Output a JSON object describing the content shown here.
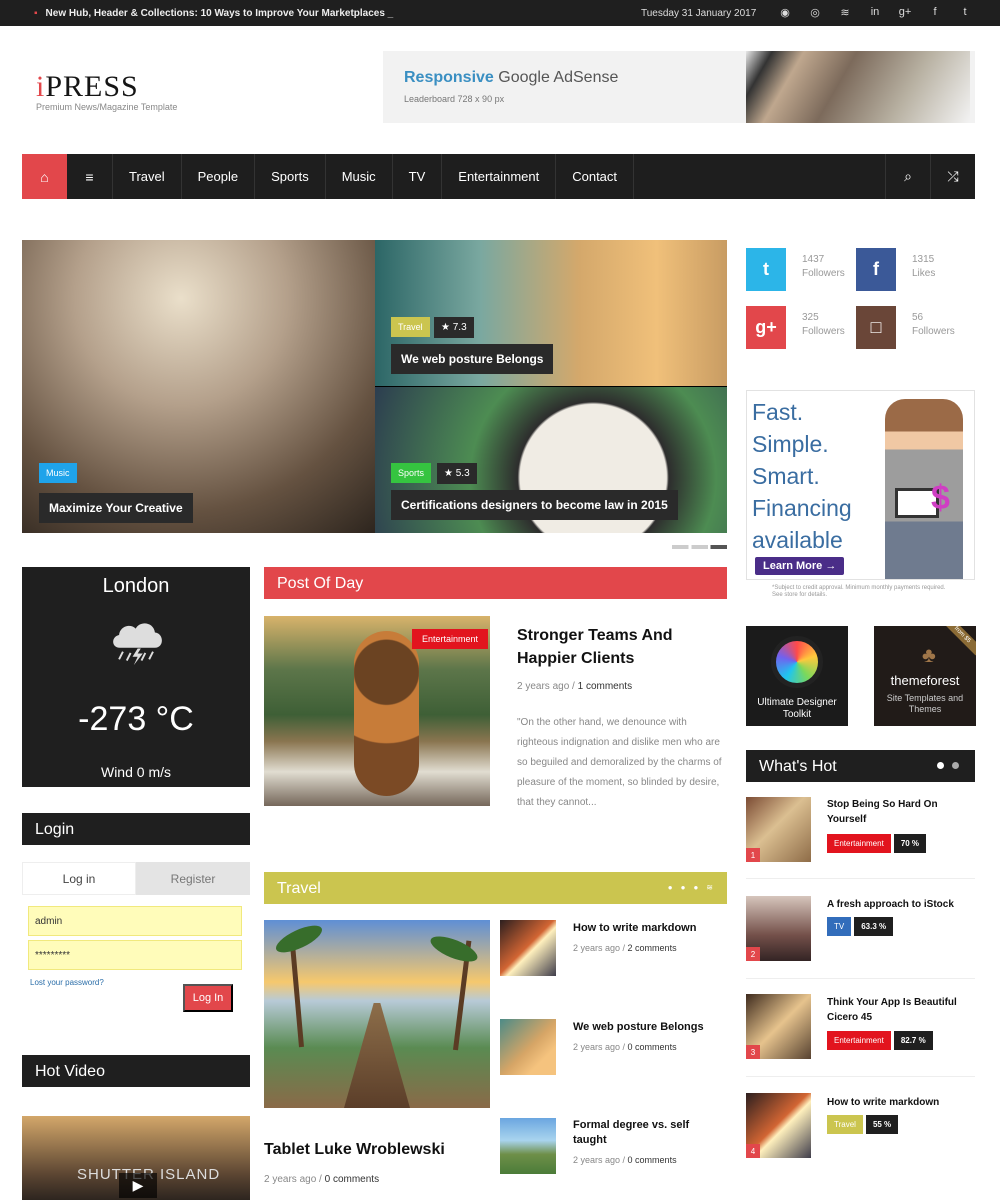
{
  "topbar": {
    "headline": "New Hub, Header & Collections: 10 Ways to Improve Your Marketplaces _",
    "date": "Tuesday 31 January 2017",
    "social_icons": [
      "github-icon",
      "dribbble-icon",
      "rss-icon",
      "linkedin-icon",
      "google-plus-icon",
      "facebook-icon",
      "twitter-icon"
    ]
  },
  "brand": {
    "logo": "iPRESS",
    "tagline": "Premium News/Magazine Template"
  },
  "ad": {
    "title_accent": "Responsive",
    "title_rest": "Google AdSense",
    "subtitle": "Leaderboard 728 x 90 px"
  },
  "nav": {
    "items": [
      "Travel",
      "People",
      "Sports",
      "Music",
      "TV",
      "Entertainment",
      "Contact"
    ],
    "home_icon": "home-icon",
    "menu_icon": "menu-icon",
    "search_icon": "search-icon",
    "shuffle_icon": "shuffle-icon"
  },
  "slider": {
    "main": {
      "tag": "Music",
      "caption": "Maximize Your Creative"
    },
    "top_right": {
      "tag": "Travel",
      "rating": "7.3",
      "caption": "We web posture Belongs"
    },
    "bottom_right": {
      "tag": "Sports",
      "rating": "5.3",
      "caption": "Certifications designers to become law in 2015"
    }
  },
  "social_counts": [
    {
      "icon": "twitter-icon",
      "symbol": "t",
      "count": "1437",
      "label": "Followers",
      "color": "#2cb5e8"
    },
    {
      "icon": "facebook-icon",
      "symbol": "f",
      "count": "1315",
      "label": "Likes",
      "color": "#3b5998"
    },
    {
      "icon": "google-plus-icon",
      "symbol": "g+",
      "count": "325",
      "label": "Followers",
      "color": "#e2474b"
    },
    {
      "icon": "instagram-icon",
      "symbol": "□",
      "count": "56",
      "label": "Followers",
      "color": "#6a4638"
    }
  ],
  "finance_ad": {
    "lines": [
      "Fast.",
      "Simple.",
      "Smart.",
      "Financing",
      "available"
    ],
    "button": "Learn More →",
    "fine_print": "*Subject to credit approval. Minimum monthly payments required. See store for details."
  },
  "weather": {
    "city": "London",
    "temperature": "-273 °C",
    "wind": "Wind 0 m/s",
    "icon": "rain-cloud-icon"
  },
  "login": {
    "heading": "Login",
    "tabs": [
      "Log in",
      "Register"
    ],
    "username": "admin",
    "password": "*********",
    "lost_password": "Lost your password?",
    "button": "Log In"
  },
  "hot_video": {
    "heading": "Hot Video",
    "video_title": "SHUTTER ISLAND",
    "play_icon": "play-icon"
  },
  "post_of_day": {
    "heading": "Post Of Day",
    "tag": "Entertainment",
    "title": "Stronger Teams And Happier Clients",
    "age": "2 years ago",
    "comments": "1 comments",
    "excerpt": "\"On the other hand, we denounce with righteous indignation and dislike men who are so beguiled and demoralized by the charms of pleasure of the moment, so blinded by desire, that they cannot..."
  },
  "travel": {
    "heading": "Travel",
    "main_title": "Tablet Luke Wroblewski",
    "main_age": "2 years ago",
    "main_comments": "0 comments",
    "items": [
      {
        "title": "How to write markdown",
        "age": "2 years ago",
        "comments": "2 comments"
      },
      {
        "title": "We web posture Belongs",
        "age": "2 years ago",
        "comments": "0 comments"
      },
      {
        "title": "Formal degree vs. self taught",
        "age": "2 years ago",
        "comments": "0 comments"
      }
    ]
  },
  "promos": [
    {
      "title": "Ultimate Designer Toolkit"
    },
    {
      "title": "themeforest",
      "subtitle": "Site Templates and Themes",
      "ribbon": "from $5"
    }
  ],
  "whats_hot": {
    "heading": "What's Hot",
    "items": [
      {
        "number": "1",
        "title": "Stop Being So Hard On Yourself",
        "tag": "Entertainment",
        "tag_color": "#e2141e",
        "percent": "70 %"
      },
      {
        "number": "2",
        "title": "A fresh approach to iStock",
        "tag": "TV",
        "tag_color": "#326dbb",
        "percent": "63.3 %"
      },
      {
        "number": "3",
        "title": "Think Your App Is Beautiful Cicero 45",
        "tag": "Entertainment",
        "tag_color": "#e2141e",
        "percent": "82.7 %"
      },
      {
        "number": "4",
        "title": "How to write markdown",
        "tag": "Travel",
        "tag_color": "#cbc54f",
        "percent": "55 %"
      }
    ]
  },
  "colors": {
    "accent": "#e2474b",
    "dark": "#1f1f1f",
    "travel": "#cbc54f",
    "music": "#1fa3ea",
    "sports": "#35c440"
  }
}
